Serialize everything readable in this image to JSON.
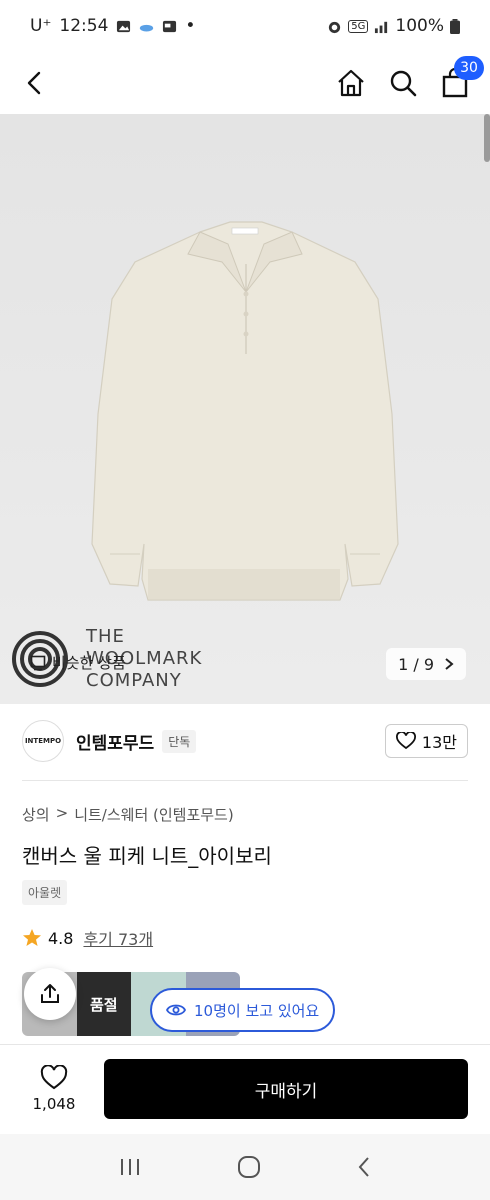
{
  "status": {
    "carrier": "U⁺",
    "time": "12:54",
    "dot": "•",
    "battery": "100%",
    "net": "5G"
  },
  "header": {
    "cart_count": "30"
  },
  "hero": {
    "similar_label": "비슷한 상품",
    "counter": "1 / 9",
    "wool_line1": "THE",
    "wool_line2": "WOOLMARK",
    "wool_line3": "COMPANY"
  },
  "brand": {
    "logo_text": "INTEMPO",
    "name": "인템포무드",
    "tag": "단독",
    "likes": "13만"
  },
  "product": {
    "breadcrumb": [
      "상의",
      ">",
      "니트/스웨터 (인템포무드)"
    ],
    "title": "캔버스 울 피케 니트_아이보리",
    "label": "아울렛",
    "rating": "4.8",
    "reviews": "후기 73개"
  },
  "thumbs": {
    "soldout": "품절"
  },
  "viewers": "10명이 보고 있어요",
  "bottom": {
    "wish_count": "1,048",
    "buy_label": "구매하기"
  },
  "colors": {
    "accent": "#2c5ad9",
    "badge": "#1e5eff",
    "star": "#f5a623"
  }
}
